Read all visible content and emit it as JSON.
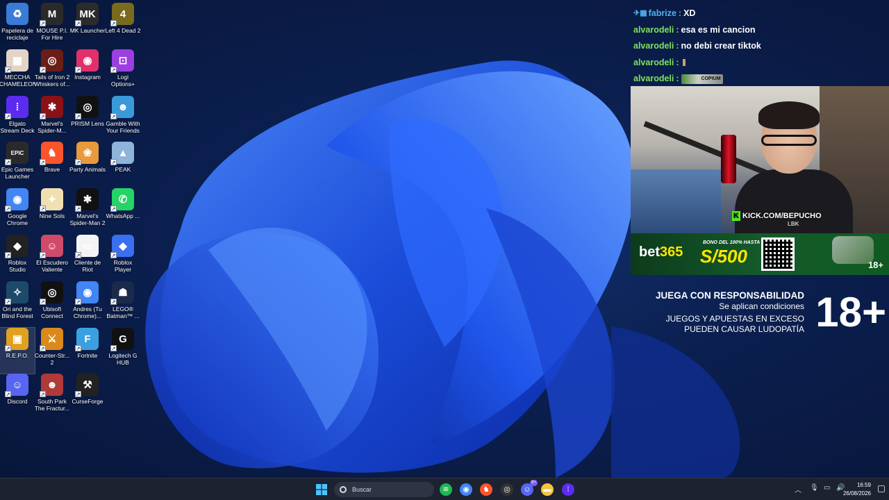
{
  "desktop_icons": [
    {
      "label": "Papelera de reciclaje",
      "icon": "recycle-bin-icon",
      "color": "#3a7bd5",
      "glyph": "♻"
    },
    {
      "label": "MOUSE P.I. For Hire",
      "icon": "mouse-pi-icon",
      "color": "#2a2a2a",
      "glyph": "M"
    },
    {
      "label": "MK Launcher",
      "icon": "mk-launcher-icon",
      "color": "#2b2b2b",
      "glyph": "MK"
    },
    {
      "label": "Left 4 Dead 2",
      "icon": "left4dead2-icon",
      "color": "#7a6a1e",
      "glyph": "4"
    },
    {
      "label": "MECCHA CHAMELEON",
      "icon": "meccha-chameleon-icon",
      "color": "#e3d5c5",
      "glyph": "▦"
    },
    {
      "label": "Tails of Iron 2 Whiskers of...",
      "icon": "tails-of-iron-icon",
      "color": "#6a1e16",
      "glyph": "◎"
    },
    {
      "label": "Instagram",
      "icon": "instagram-icon",
      "color": "#e1306c",
      "glyph": "◉"
    },
    {
      "label": "Logi Options+",
      "icon": "logi-options-icon",
      "color": "#9b3fe0",
      "glyph": "⊡"
    },
    {
      "label": "Elgato Stream Deck",
      "icon": "elgato-stream-deck-icon",
      "color": "#5b2cf0",
      "glyph": "⁞"
    },
    {
      "label": "Marvel's Spider-M...",
      "icon": "spiderman-icon",
      "color": "#8a1116",
      "glyph": "✱"
    },
    {
      "label": "PRISM Lens",
      "icon": "prism-lens-icon",
      "color": "#111111",
      "glyph": "◎"
    },
    {
      "label": "Gamble With Your Friends",
      "icon": "gamble-friends-icon",
      "color": "#3a9ad9",
      "glyph": "☻"
    },
    {
      "label": "Epic Games Launcher",
      "icon": "epic-games-icon",
      "color": "#2a2a2a",
      "glyph": "EPIC"
    },
    {
      "label": "Brave",
      "icon": "brave-icon",
      "color": "#fb542b",
      "glyph": "♞"
    },
    {
      "label": "Party Animals",
      "icon": "party-animals-icon",
      "color": "#e89a3c",
      "glyph": "❀"
    },
    {
      "label": "PEAK",
      "icon": "peak-icon",
      "color": "#8fb4d9",
      "glyph": "▲"
    },
    {
      "label": "Google Chrome",
      "icon": "chrome-icon",
      "color": "#4285f4",
      "glyph": "◉"
    },
    {
      "label": "Nine Sols",
      "icon": "nine-sols-icon",
      "color": "#f0e0b0",
      "glyph": "✦"
    },
    {
      "label": "Marvel's Spider-Man 2",
      "icon": "spiderman2-icon",
      "color": "#111111",
      "glyph": "✱"
    },
    {
      "label": "WhatsApp ...",
      "icon": "whatsapp-icon",
      "color": "#25d366",
      "glyph": "✆"
    },
    {
      "label": "Roblox Studio",
      "icon": "roblox-studio-icon",
      "color": "#222222",
      "glyph": "◆"
    },
    {
      "label": "El Escudero Valiente",
      "icon": "escudero-valiente-icon",
      "color": "#d04a6a",
      "glyph": "☺"
    },
    {
      "label": "Cliente de Riot",
      "icon": "riot-client-icon",
      "color": "#f4f4f4",
      "glyph": "▭"
    },
    {
      "label": "Roblox Player",
      "icon": "roblox-player-icon",
      "color": "#3a6ff0",
      "glyph": "◆"
    },
    {
      "label": "Ori and the Blind Forest",
      "icon": "ori-icon",
      "color": "#1e4a6a",
      "glyph": "✧"
    },
    {
      "label": "Ubisoft Connect",
      "icon": "ubisoft-icon",
      "color": "#111111",
      "glyph": "◎"
    },
    {
      "label": "Andres (Tu Chrome)...",
      "icon": "chrome-profile-icon",
      "color": "#4285f4",
      "glyph": "◉"
    },
    {
      "label": "LEGO® Batman™ ...",
      "icon": "lego-batman-icon",
      "color": "#1a2a4a",
      "glyph": "☗"
    },
    {
      "label": "R.E.P.O.",
      "icon": "repo-icon",
      "color": "#e0a020",
      "glyph": "▣"
    },
    {
      "label": "Counter-Str... 2",
      "icon": "cs2-icon",
      "color": "#d98a1a",
      "glyph": "⚔"
    },
    {
      "label": "Fortnite",
      "icon": "fortnite-icon",
      "color": "#3aa0e0",
      "glyph": "F"
    },
    {
      "label": "Logitech G HUB",
      "icon": "logitech-ghub-icon",
      "color": "#111111",
      "glyph": "G"
    },
    {
      "label": "Discord",
      "icon": "discord-icon",
      "color": "#5865f2",
      "glyph": "☺"
    },
    {
      "label": "South Park The Fractur...",
      "icon": "south-park-icon",
      "color": "#b03a3a",
      "glyph": "☻"
    },
    {
      "label": "CurseForge",
      "icon": "curseforge-icon",
      "color": "#222222",
      "glyph": "⚒"
    }
  ],
  "chat": [
    {
      "user": "fabrize",
      "text": "XD",
      "badge": true
    },
    {
      "user": "alvarodeli",
      "text": "esa es mi cancion"
    },
    {
      "user": "alvarodeli",
      "text": "no debi crear tiktok"
    },
    {
      "user": "alvarodeli",
      "text": ""
    },
    {
      "user": "alvarodeli",
      "text": "",
      "emote": "COPIUM"
    }
  ],
  "webcam": {
    "overlay_text": "KICK.COM/BEPUCHO",
    "badge_text": "LBK"
  },
  "bet_banner": {
    "brand_main": "bet",
    "brand_accent": "365",
    "promo_top": "BONO DEL 100% HASTA",
    "promo_amount": "S/500",
    "age": "18+"
  },
  "responsible": {
    "line1": "JUEGA CON RESPONSABILIDAD",
    "line2": "Se aplican condiciones",
    "line3": "JUEGOS Y APUESTAS EN EXCESO",
    "line4": "PUEDEN CAUSAR LUDOPATÍA",
    "big": "18+"
  },
  "taskbar": {
    "search_placeholder": "Buscar",
    "apps": [
      {
        "name": "spotify-icon",
        "color": "#1db954",
        "glyph": "≋"
      },
      {
        "name": "chrome-taskbar-icon",
        "color": "#4285f4",
        "glyph": "◉"
      },
      {
        "name": "brave-taskbar-icon",
        "color": "#fb542b",
        "glyph": "♞"
      },
      {
        "name": "obs-taskbar-icon",
        "color": "#333333",
        "glyph": "◎"
      },
      {
        "name": "discord-taskbar-icon",
        "color": "#5865f2",
        "glyph": "☺"
      },
      {
        "name": "file-explorer-icon",
        "color": "#f4c542",
        "glyph": "▬"
      },
      {
        "name": "stream-deck-taskbar-icon",
        "color": "#5b2cf0",
        "glyph": "⁞"
      }
    ],
    "discord_badge": "9+",
    "time": "16:59",
    "date": "26/08/2026"
  }
}
